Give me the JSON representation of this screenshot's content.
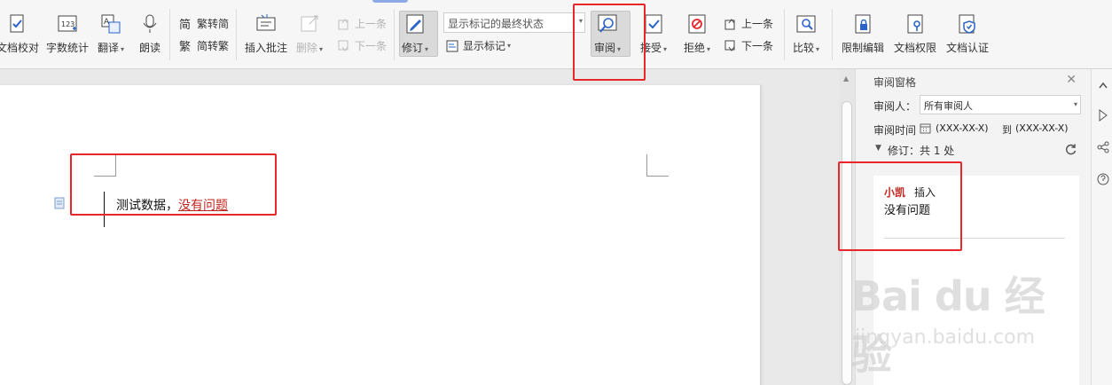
{
  "ribbon": {
    "proofread": "文档校对",
    "word_count": "字数统计",
    "translate": "翻译",
    "read_aloud": "朗读",
    "trad_to_simp": "繁转简",
    "simp_to_trad": "简转繁",
    "insert_comment": "插入批注",
    "delete": "删除",
    "prev_item": "上一条",
    "next_item": "下一条",
    "track_changes": "修订",
    "display_mode": "显示标记的最终状态",
    "show_markup": "显示标记",
    "review": "审阅",
    "accept": "接受",
    "reject": "拒绝",
    "prev_change": "上一条",
    "next_change": "下一条",
    "compare": "比较",
    "restrict_edit": "限制编辑",
    "doc_permission": "文档权限",
    "doc_certify": "文档认证"
  },
  "document": {
    "text_before": "测试数据，",
    "inserted_text": "没有问题"
  },
  "pane": {
    "title": "审阅窗格",
    "reviewer_label": "审阅人：",
    "reviewer_value": "所有审阅人",
    "time_label": "审阅时间",
    "date_from": "(XXX-XX-X)",
    "to_label": "到",
    "date_to": "(XXX-XX-X)",
    "summary": "修订：共 1 处",
    "card": {
      "author": "小凯",
      "action": "插入",
      "content": "没有问题"
    }
  },
  "watermark": {
    "brand": "Bai du 经验",
    "url": "jingyan.baidu.com"
  },
  "colors": {
    "highlight_box": "#e8262c",
    "insert_text": "#c0261f"
  }
}
